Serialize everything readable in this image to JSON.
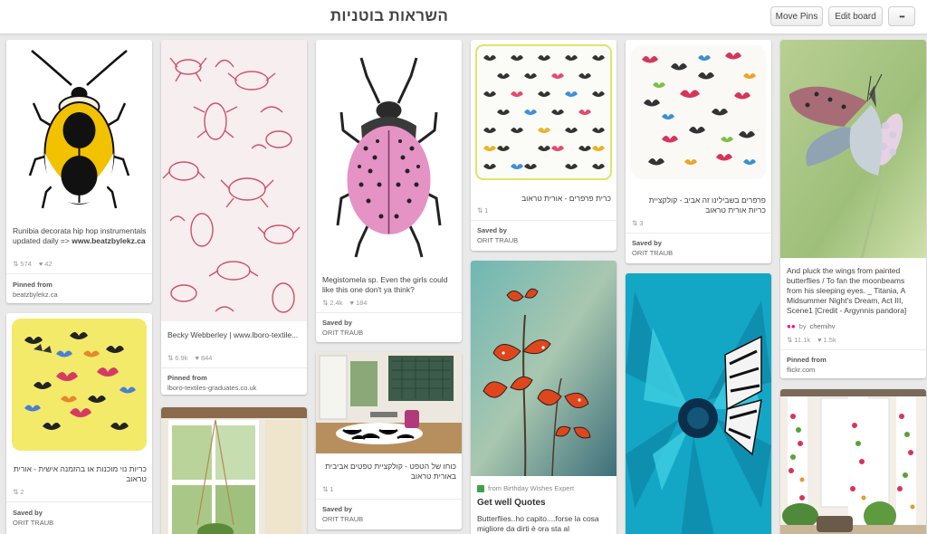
{
  "header": {
    "title": "השראות בוטניות",
    "move_pins": "Move Pins",
    "edit_board": "Edit board",
    "more": "•••"
  },
  "pins": {
    "beetle_yellow": {
      "desc": "Runibia decorata hip hop instrumentals updated daily => ",
      "desc_bold": "www.beatzbylekz.ca",
      "repins": "574",
      "likes": "42",
      "attr_label": "Pinned from",
      "attr_value": "beatzbylekz.ca"
    },
    "textile_red": {
      "desc": "Becky Webberley | www.lboro-textile...",
      "repins": "6.9k",
      "likes": "844",
      "attr_label": "Pinned from",
      "attr_value": "lboro-textiles-graduates.co.uk"
    },
    "beetle_pink": {
      "desc": "Megistomela sp. Even the girls could like this one don't ya think?",
      "repins": "2.4k",
      "likes": "184",
      "attr_label": "Saved by",
      "attr_value": "ORIT TRAUB"
    },
    "pillow_butterflies": {
      "desc": "כרית פרפרים - אורית טראוב",
      "repins": "1",
      "attr_label": "Saved by",
      "attr_value": "ORIT TRAUB"
    },
    "pillow_white": {
      "desc": "פרפרים בשבילינו זה אביב - קולקציית כריות אורית טראוב",
      "repins": "3",
      "attr_label": "Saved by",
      "attr_value": "ORIT TRAUB"
    },
    "butterfly_flower": {
      "desc": "And pluck the wings from painted butterflies / To fan the moonbeams from his sleeping eyes. _ Titania, A Midsummer Night's Dream, Act III, Scene1 [Credit - Argynnis pandora]",
      "by_label": "by",
      "by_value": "chemihv",
      "repins": "11.1k",
      "likes": "1.5k",
      "attr_label": "Pinned from",
      "attr_value": "flickr.com"
    },
    "pillow_yellow": {
      "desc": "כריות נוי מוכנות או בהזמנה אישית - אורית טראוב",
      "repins": "2",
      "attr_label": "Saved by",
      "attr_value": "ORIT TRAUB"
    },
    "room_zebra": {
      "desc": "כוחו של הטפט - קולקציית טפטים אביבית באורית טראוב",
      "repins": "1",
      "attr_label": "Saved by",
      "attr_value": "ORIT TRAUB"
    },
    "red_butterflies": {
      "via_label": "from Birthday Wishes Expert",
      "title": "Get well Quotes",
      "desc": "Butterflies..ho capito....forse la cosa migliore da dirti è ora sta al"
    }
  },
  "colors": {
    "background": "#e9e9e9",
    "card": "#ffffff",
    "stat_gray": "#999999"
  }
}
